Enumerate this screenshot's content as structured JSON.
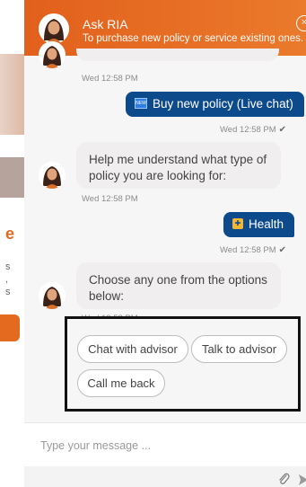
{
  "header": {
    "title": "Ask RIA",
    "subtitle": "To purchase new policy or service existing ones."
  },
  "messages": [
    {
      "time": "Wed 12:58 PM"
    },
    {
      "text": "Buy new policy (Live chat)",
      "badge": "NEW",
      "time": "Wed 12:58 PM"
    },
    {
      "text": "Help me understand what type of policy you are looking for:",
      "time": "Wed 12:58 PM"
    },
    {
      "text": "Health",
      "time": "Wed 12:58 PM"
    },
    {
      "text": "Choose any one from the options below:",
      "time": "Wed 12:58 PM"
    }
  ],
  "options": [
    "Chat with advisor",
    "Talk to advisor",
    "Call me back"
  ],
  "composer": {
    "placeholder": "Type your message ..."
  },
  "colors": {
    "header_orange": "#e2601c",
    "user_bubble": "#0d4a8c",
    "bot_bubble": "#f0eeee"
  },
  "icons": {
    "close": "close-icon",
    "attach": "paperclip-icon",
    "send": "send-icon",
    "read_receipt": "checkmark-icon"
  }
}
